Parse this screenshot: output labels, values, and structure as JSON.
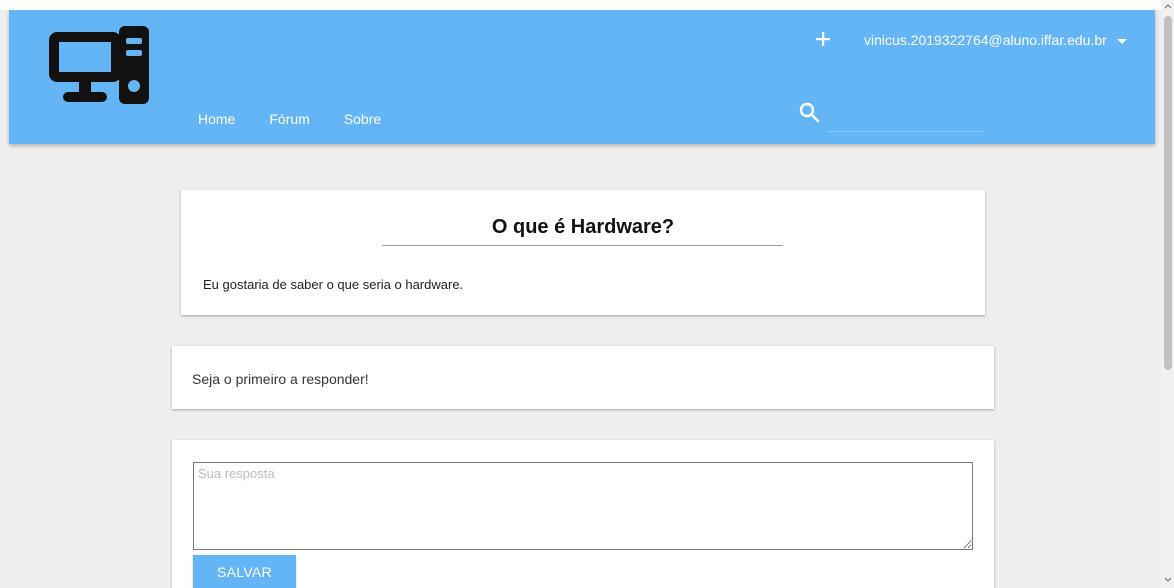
{
  "header": {
    "nav": [
      {
        "label": "Home"
      },
      {
        "label": "Fórum"
      },
      {
        "label": "Sobre"
      }
    ],
    "user_email": "vinicus.2019322764@aluno.iffar.edu.br",
    "search_placeholder": ""
  },
  "question": {
    "title": "O que é Hardware?",
    "body": "Eu gostaria de saber o que seria o hardware."
  },
  "answers": {
    "empty_message": "Seja o primeiro a responder!"
  },
  "reply": {
    "placeholder": "Sua resposta",
    "save_label": "SALVAR"
  },
  "colors": {
    "header_bg": "#64b5f6",
    "page_bg": "#eeeeee",
    "button_bg": "#64b5f6"
  },
  "icons": [
    "computer-logo-icon",
    "plus-icon",
    "caret-down-icon",
    "search-icon"
  ]
}
